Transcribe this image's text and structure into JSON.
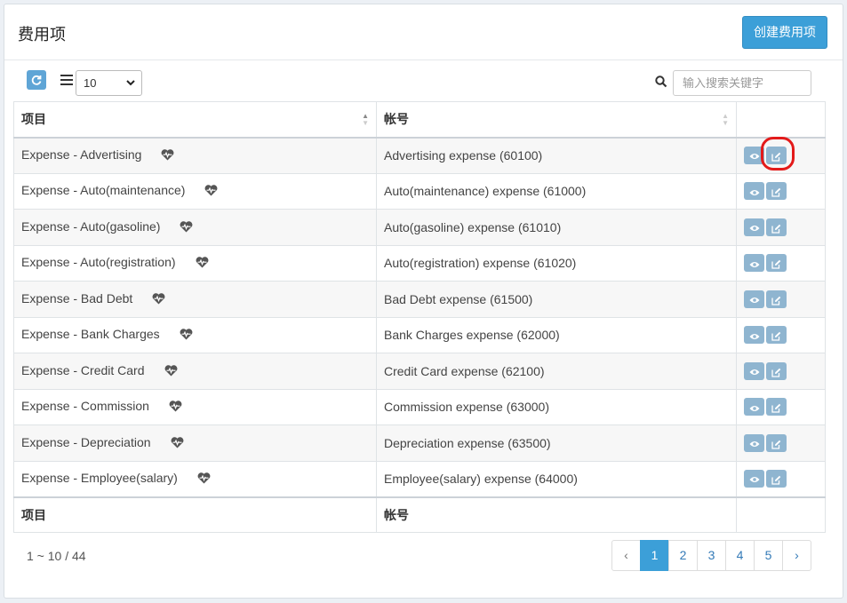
{
  "header": {
    "title": "费用项",
    "create_label": "创建费用项"
  },
  "toolbar": {
    "refresh_icon": "refresh-icon",
    "list_icon": "list-icon",
    "page_size": "10",
    "search_placeholder": "输入搜索关键字"
  },
  "table": {
    "columns": [
      "项目",
      "帐号"
    ],
    "rows": [
      {
        "item": "Expense - Advertising",
        "account": "Advertising expense (60100)"
      },
      {
        "item": "Expense - Auto(maintenance)",
        "account": "Auto(maintenance) expense (61000)"
      },
      {
        "item": "Expense - Auto(gasoline)",
        "account": "Auto(gasoline) expense (61010)"
      },
      {
        "item": "Expense - Auto(registration)",
        "account": "Auto(registration) expense (61020)"
      },
      {
        "item": "Expense - Bad Debt",
        "account": "Bad Debt expense (61500)"
      },
      {
        "item": "Expense - Bank Charges",
        "account": "Bank Charges expense (62000)"
      },
      {
        "item": "Expense - Credit Card",
        "account": "Credit Card expense (62100)"
      },
      {
        "item": "Expense - Commission",
        "account": "Commission expense (63000)"
      },
      {
        "item": "Expense - Depreciation",
        "account": "Depreciation expense (63500)"
      },
      {
        "item": "Expense - Employee(salary)",
        "account": "Employee(salary) expense (64000)"
      }
    ],
    "footer": [
      "项目",
      "帐号"
    ]
  },
  "pagination": {
    "summary": "1 ~ 10 / 44",
    "prev": "‹",
    "pages": [
      "1",
      "2",
      "3",
      "4",
      "5"
    ],
    "next": "›",
    "active_page": "1"
  },
  "colors": {
    "primary": "#3c9fd8",
    "action": "#8fb5d0",
    "highlight": "#e31a1a"
  }
}
